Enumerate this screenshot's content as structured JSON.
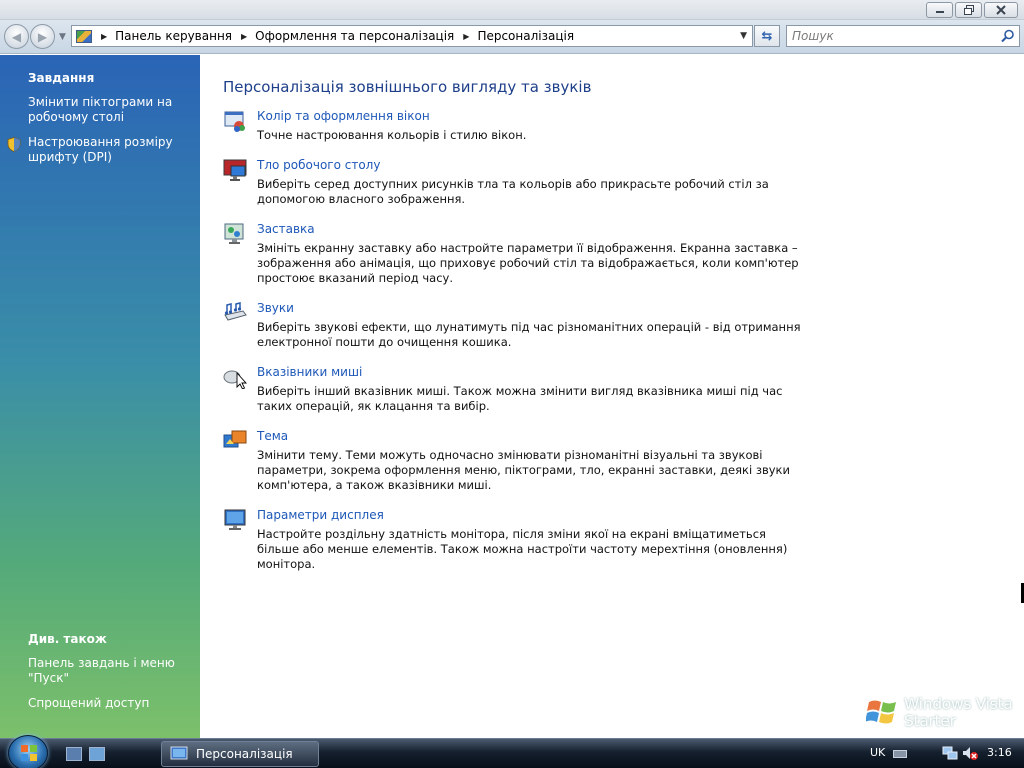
{
  "address_bar": {
    "crumbs": [
      "Панель керування",
      "Оформлення та персоналізація",
      "Персоналізація"
    ]
  },
  "search": {
    "placeholder": "Пошук"
  },
  "sidebar": {
    "tasks_heading": "Завдання",
    "tasks": [
      {
        "label": "Змінити піктограми на робочому столі",
        "icon": null
      },
      {
        "label": "Настроювання розміру шрифту (DPI)",
        "icon": "shield-icon"
      }
    ],
    "see_also_heading": "Див. також",
    "see_also": [
      {
        "label": "Панель завдань і меню \"Пуск\""
      },
      {
        "label": "Спрощений доступ"
      }
    ]
  },
  "main": {
    "title": "Персоналізація зовнішнього вигляду та звуків",
    "items": [
      {
        "icon": "window-color-icon",
        "link": "Колір та оформлення вікон",
        "description": "Точне настроювання кольорів і стилю вікон."
      },
      {
        "icon": "desktop-background-icon",
        "link": "Тло робочого столу",
        "description": "Виберіть серед доступних рисунків тла та кольорів або прикрасьте робочий стіл за допомогою власного зображення."
      },
      {
        "icon": "screensaver-icon",
        "link": "Заставка",
        "description": "Змініть екранну заставку або настройте параметри її відображення. Екранна заставка – зображення або анімація, що приховує робочий стіл та відображається, коли комп'ютер простоює вказаний період часу."
      },
      {
        "icon": "sounds-icon",
        "link": "Звуки",
        "description": "Виберіть звукові ефекти, що лунатимуть під час різноманітних операцій - від отримання електронної пошти до очищення кошика."
      },
      {
        "icon": "mouse-pointer-icon",
        "link": "Вказівники миші",
        "description": "Виберіть інший вказівник миші. Також можна змінити вигляд вказівника миші під час таких операцій, як клацання та вибір."
      },
      {
        "icon": "theme-icon",
        "link": "Тема",
        "description": "Змінити тему. Теми можуть одночасно змінювати різноманітні візуальні та звукові параметри, зокрема оформлення меню, піктограми, тло, екранні заставки, деякі звуки комп'ютера, а також вказівники миші."
      },
      {
        "icon": "display-settings-icon",
        "link": "Параметри дисплея",
        "description": "Настройте роздільну здатність монітора, після зміни якої на екрані вміщатиметься більше або менше елементів. Також можна настроїти частоту мерехтіння (оновлення) монітора."
      }
    ]
  },
  "branding": {
    "line1": "Windows Vista",
    "line2": "Starter"
  },
  "taskbar": {
    "active_window": "Персоналізація",
    "language": "UK",
    "clock": "3:16"
  },
  "colors": {
    "link": "#1e58b8",
    "title": "#1e3f8a",
    "sidebar_top": "#2a64b6",
    "sidebar_bottom": "#7cc06a"
  }
}
